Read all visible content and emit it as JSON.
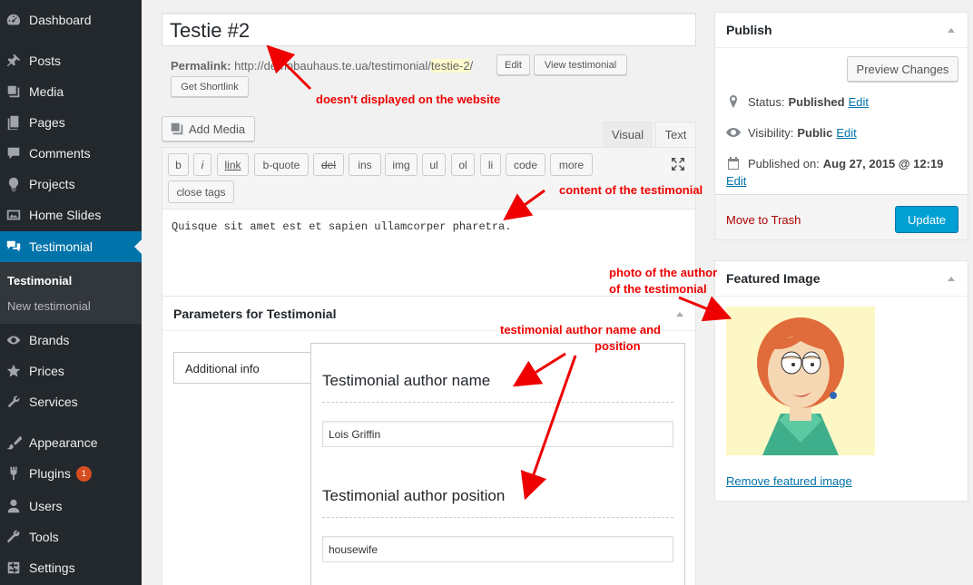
{
  "sidebar": {
    "items": [
      {
        "label": "Dashboard",
        "icon": "dashboard-icon"
      },
      {
        "label": "Posts",
        "icon": "pin-icon"
      },
      {
        "label": "Media",
        "icon": "media-icon"
      },
      {
        "label": "Pages",
        "icon": "pages-icon"
      },
      {
        "label": "Comments",
        "icon": "comment-icon"
      },
      {
        "label": "Projects",
        "icon": "lightbulb-icon"
      },
      {
        "label": "Home Slides",
        "icon": "slides-icon"
      },
      {
        "label": "Testimonial",
        "icon": "testimonial-icon"
      },
      {
        "label": "Brands",
        "icon": "eye-icon"
      },
      {
        "label": "Prices",
        "icon": "star-icon"
      },
      {
        "label": "Services",
        "icon": "wrench-icon"
      },
      {
        "label": "Appearance",
        "icon": "brush-icon"
      },
      {
        "label": "Plugins",
        "icon": "plugin-icon",
        "badge": "1"
      },
      {
        "label": "Users",
        "icon": "user-icon"
      },
      {
        "label": "Tools",
        "icon": "tools-icon"
      },
      {
        "label": "Settings",
        "icon": "settings-icon"
      }
    ],
    "submenu": [
      "Testimonial",
      "New testimonial"
    ]
  },
  "post": {
    "title": "Testie #2",
    "permalink_label": "Permalink:",
    "permalink_base": "http://demobauhaus.te.ua/testimonial/",
    "permalink_slug": "testie-2",
    "permalink_end": "/",
    "edit_btn": "Edit",
    "view_btn": "View testimonial",
    "shortlink_btn": "Get Shortlink"
  },
  "editor": {
    "add_media": "Add Media",
    "tab_visual": "Visual",
    "tab_text": "Text",
    "quicktags": [
      "b",
      "i",
      "link",
      "b-quote",
      "del",
      "ins",
      "img",
      "ul",
      "ol",
      "li",
      "code",
      "more",
      "close tags"
    ],
    "content": "Quisque sit amet est et sapien ullamcorper pharetra."
  },
  "params": {
    "title": "Parameters for Testimonial",
    "tab": "Additional info",
    "author_name_label": "Testimonial author name",
    "author_name_value": "Lois Griffin",
    "author_position_label": "Testimonial author position",
    "author_position_value": "housewife"
  },
  "publish": {
    "title": "Publish",
    "preview": "Preview Changes",
    "status_label": "Status:",
    "status_value": "Published",
    "visibility_label": "Visibility:",
    "visibility_value": "Public",
    "published_label": "Published on:",
    "published_value": "Aug 27, 2015 @ 12:19",
    "edit": "Edit",
    "trash": "Move to Trash",
    "update": "Update"
  },
  "featured": {
    "title": "Featured Image",
    "remove": "Remove featured image"
  },
  "annotations": {
    "permalink_note": "doesn't displayed on the website",
    "content_note": "content of the testimonial",
    "photo_note_1": "photo of the author",
    "photo_note_2": "of the testimonial",
    "author_note_1": "testimonial author name and",
    "author_note_2": "position"
  },
  "colors": {
    "sidebar_bg": "#23282d",
    "current_menu": "#0073aa",
    "update_button": "#00a0d2",
    "annotation": "#ee0000"
  }
}
